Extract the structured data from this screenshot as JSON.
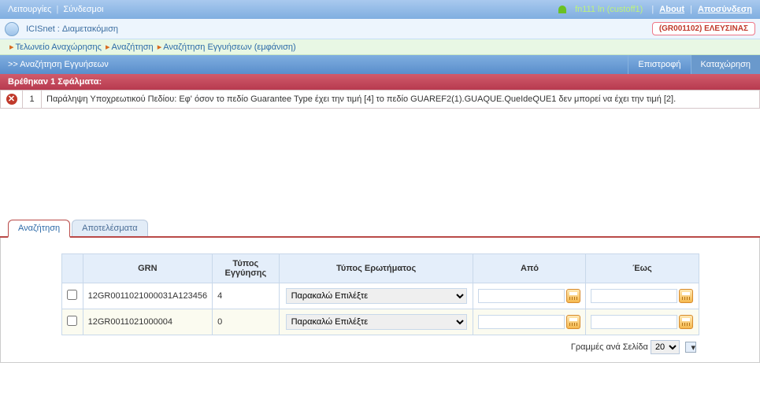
{
  "topbar": {
    "menu_functions": "Λειτουργίες",
    "menu_links": "Σύνδεσμοι",
    "user": "fn111 ln (custoff1)",
    "about": "About",
    "logout": "Αποσύνδεση"
  },
  "appbar": {
    "title": "ICISnet : Διαμετακόμιση",
    "office": "(GR001102) ΕΛΕΥΣΙΝΑΣ"
  },
  "breadcrumbs": {
    "b0": "Τελωνείο Αναχώρησης",
    "b1": "Αναζήτηση",
    "b2": "Αναζήτηση Εγγυήσεων (εμφάνιση)"
  },
  "section": {
    "title": ">> Αναζήτηση Εγγυήσεων",
    "return_btn": "Επιστροφή",
    "submit_btn": "Καταχώρηση"
  },
  "errors": {
    "header": "Βρέθηκαν 1 Σφάλματα:",
    "rows": {
      "0": {
        "num": "1",
        "msg": "Παράληψη Υποχρεωτικού Πεδίου: Εφ' όσον το πεδίο Guarantee Type έχει την τιμή [4] το πεδίο GUAREF2(1).GUAQUE.QueIdeQUE1 δεν μπορεί να έχει την τιμή [2]."
      }
    }
  },
  "tabs": {
    "search": "Αναζήτηση",
    "results": "Αποτελέσματα"
  },
  "grid": {
    "hdr_grn": "GRN",
    "hdr_type": "Τύπος Εγγύησης",
    "hdr_qtype": "Τύπος Ερωτήματος",
    "hdr_from": "Από",
    "hdr_to": "Έως",
    "select_placeholder": "Παρακαλώ Επιλέξτε",
    "rows": {
      "0": {
        "grn": "12GR0011021000031A123456",
        "gtype": "4"
      },
      "1": {
        "grn": "12GR0011021000004",
        "gtype": "0"
      }
    }
  },
  "pager": {
    "label": "Γραμμές ανά Σελίδα",
    "value": "20"
  }
}
